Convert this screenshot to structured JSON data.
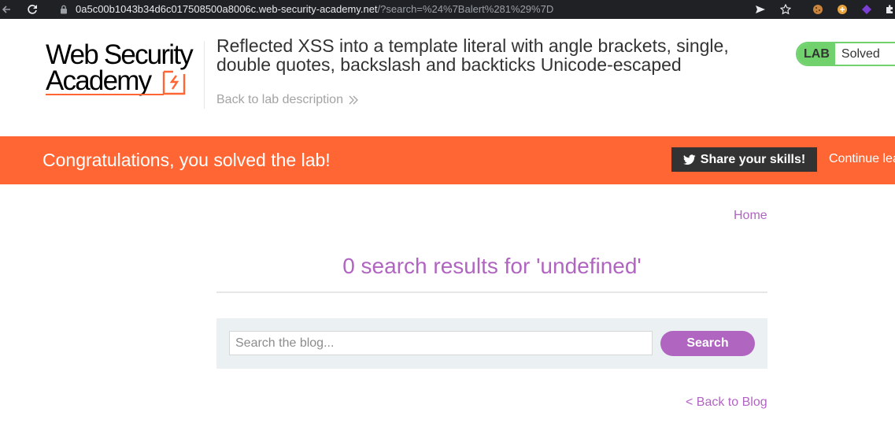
{
  "browser": {
    "url_host": "0a5c00b1043b34d6c017508500a8006c.web-security-academy.net",
    "url_rest": "/?search=%24%7Balert%281%29%7D",
    "icons": [
      "back-arrow-icon",
      "reload-icon",
      "lock-icon",
      "send-icon",
      "star-icon",
      "cookie-icon",
      "extension-icon",
      "puzzle-icon"
    ]
  },
  "header": {
    "logo_line1": "Web Security",
    "logo_line2": "Academy",
    "lab_title": "Reflected XSS into a template literal with angle brackets, single, double quotes, backslash and backticks Unicode-escaped",
    "back_to_description": "Back to lab description",
    "lab_badge": {
      "label": "LAB",
      "status": "Solved",
      "color": "#70d16d"
    }
  },
  "banner": {
    "message": "Congratulations, you solved the lab!",
    "share_label": "Share your skills!",
    "continue_label": "Continue learning",
    "color": "#ff6633"
  },
  "nav": {
    "home": "Home"
  },
  "main": {
    "results_title": "0 search results for 'undefined'",
    "search": {
      "placeholder": "Search the blog...",
      "button_label": "Search"
    },
    "back_to_blog": "< Back to Blog",
    "accent_color": "#b065c1"
  }
}
